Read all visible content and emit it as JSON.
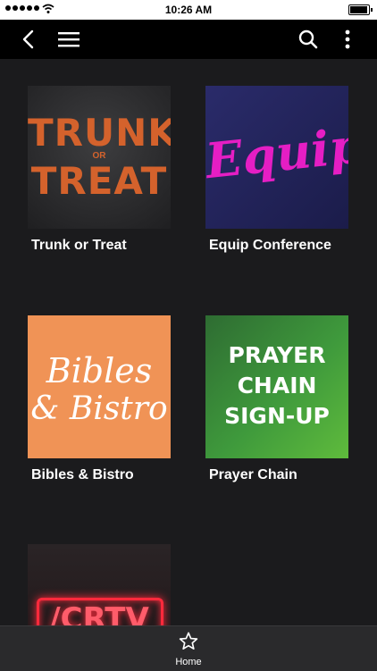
{
  "status_bar": {
    "time": "10:26 AM",
    "signal_icon": "signal-dots-icon",
    "wifi_icon": "wifi-icon",
    "battery_icon": "battery-icon"
  },
  "nav_bar": {
    "back_icon": "chevron-left-icon",
    "menu_icon": "hamburger-menu-icon",
    "search_icon": "search-icon",
    "more_icon": "more-vertical-icon"
  },
  "items": [
    {
      "title": "Trunk or Treat",
      "artwork": {
        "line1": "TRUNK",
        "line2": "OR",
        "line3": "TREAT"
      }
    },
    {
      "title": "Equip Conference",
      "artwork": {
        "line1": "Equip"
      }
    },
    {
      "title": "Bibles & Bistro",
      "artwork": {
        "line1": "Bibles",
        "line2": "& Bistro"
      }
    },
    {
      "title": "Prayer Chain",
      "artwork": {
        "line1": "PRAYER",
        "line2": "CHAIN",
        "line3": "SIGN-UP"
      }
    },
    {
      "title": "",
      "artwork": {
        "line1": "/CRTV"
      }
    }
  ],
  "tab_bar": {
    "home_label": "Home",
    "home_icon": "star-icon"
  },
  "colors": {
    "background": "#1b1b1d",
    "nav_bar": "#000000",
    "tab_bar": "#2a2a2c",
    "trunk_orange": "#d4622c",
    "equip_magenta": "#e51ec4",
    "bistro_orange": "#f09356",
    "prayer_green": "#3f9a3c",
    "neon_red": "#ff2a3c"
  }
}
